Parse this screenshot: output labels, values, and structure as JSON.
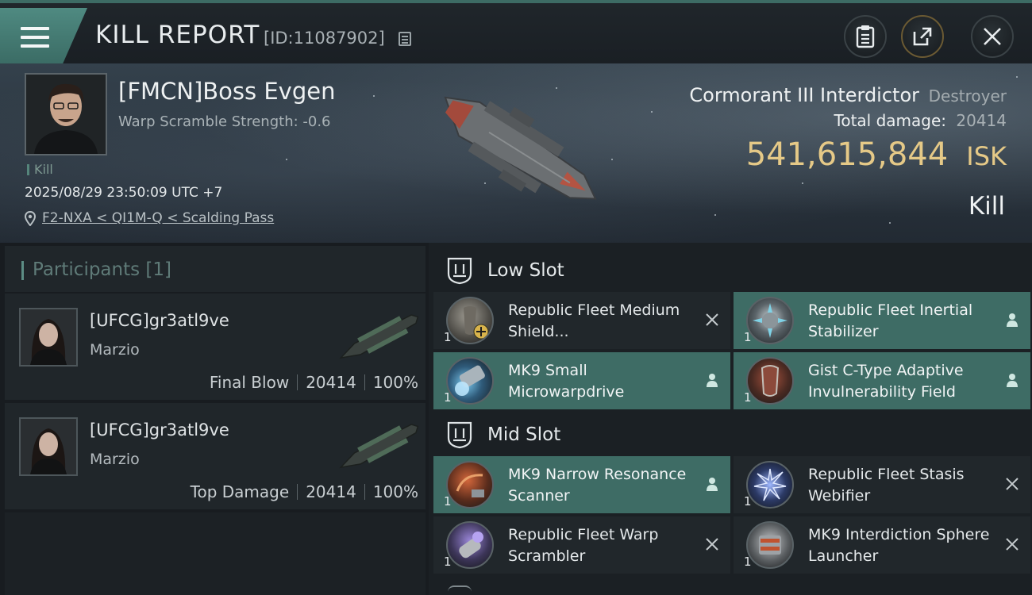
{
  "header": {
    "title": "KILL REPORT",
    "report_id": "[ID:11087902]",
    "icons": {
      "menu": "hamburger-menu-icon",
      "copy": "copy-icon",
      "clipboard": "clipboard-icon",
      "share": "share-export-icon",
      "close": "close-icon"
    }
  },
  "victim": {
    "name": "[FMCN]Boss Evgen",
    "warp_scramble": "Warp Scramble Strength: -0.6",
    "kill_tag": "Kill",
    "timestamp": "2025/08/29 23:50:09 UTC +7",
    "location": "F2-NXA < QI1M-Q < Scalding Pass",
    "ship_name": "Cormorant III Interdictor",
    "ship_class": "Destroyer",
    "total_damage_label": "Total damage:",
    "total_damage": "20414",
    "isk_value": "541,615,844",
    "isk_unit": "ISK",
    "result": "Kill"
  },
  "participants": {
    "title": "Participants [1]",
    "items": [
      {
        "name": "[UFCG]gr3atl9ve",
        "ship": "Marzio",
        "role": "Final Blow",
        "damage": "20414",
        "percent": "100%"
      },
      {
        "name": "[UFCG]gr3atl9ve",
        "ship": "Marzio",
        "role": "Top Damage",
        "damage": "20414",
        "percent": "100%"
      }
    ]
  },
  "slots": {
    "low": {
      "title": "Low Slot",
      "modules": [
        {
          "name": "Republic Fleet Medium Shield...",
          "qty": "1",
          "status": "destroyed"
        },
        {
          "name": "Republic Fleet Inertial Stabilizer",
          "qty": "1",
          "status": "dropped"
        },
        {
          "name": "MK9 Small Microwarpdrive",
          "qty": "1",
          "status": "dropped"
        },
        {
          "name": "Gist C-Type Adaptive Invulnerability Field",
          "qty": "1",
          "status": "dropped"
        }
      ]
    },
    "mid": {
      "title": "Mid Slot",
      "modules": [
        {
          "name": "MK9 Narrow Resonance Scanner",
          "qty": "1",
          "status": "dropped"
        },
        {
          "name": "Republic Fleet Stasis Webifier",
          "qty": "1",
          "status": "destroyed"
        },
        {
          "name": "Republic Fleet Warp Scrambler",
          "qty": "1",
          "status": "destroyed"
        },
        {
          "name": "MK9 Interdiction Sphere Launcher",
          "qty": "1",
          "status": "destroyed"
        }
      ]
    }
  },
  "colors": {
    "accent_teal": "#3e6c65",
    "isk_gold": "#e5c987",
    "background": "#15191d"
  }
}
